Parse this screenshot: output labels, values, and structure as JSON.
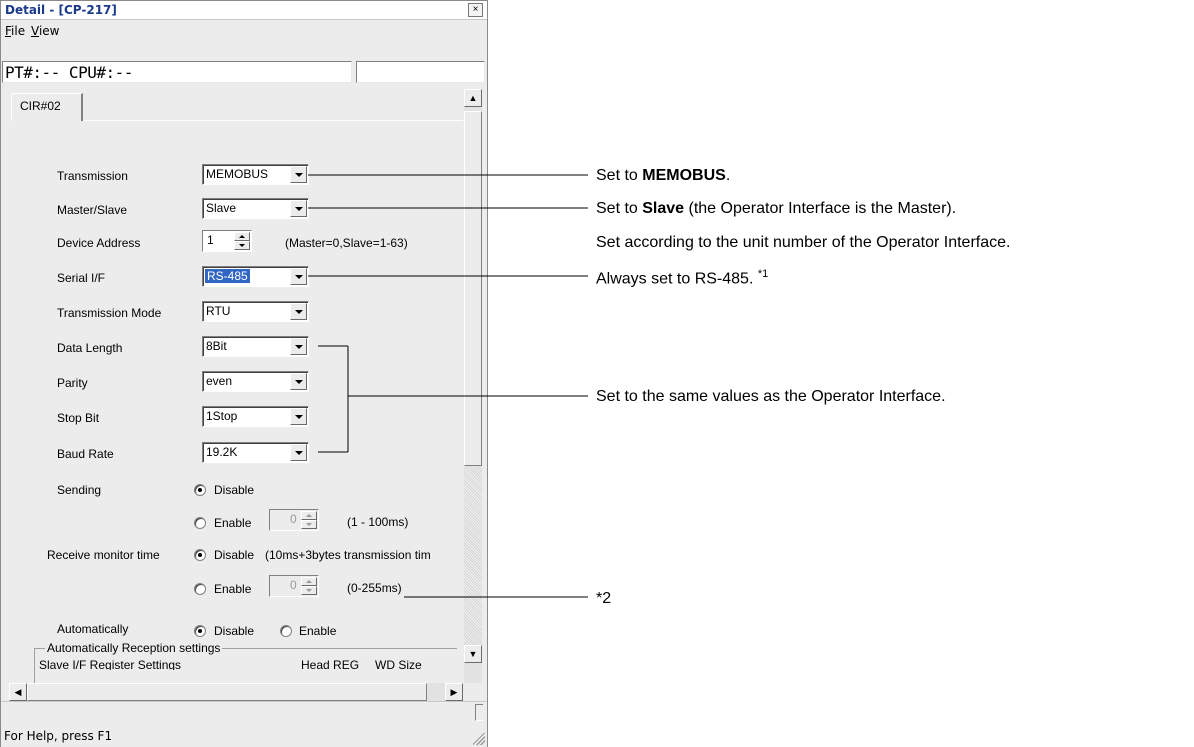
{
  "window": {
    "title": "Detail - [CP-217]",
    "close_label": "×",
    "menu": [
      {
        "underline": "F",
        "rest": "ile"
      },
      {
        "underline": "V",
        "rest": "iew"
      }
    ],
    "pt_cpu": "PT#:-- CPU#:--",
    "tab": "CIR#02",
    "status_help": "For Help, press F1"
  },
  "form": {
    "transmission": {
      "label": "Transmission",
      "value": "MEMOBUS"
    },
    "master_slave": {
      "label": "Master/Slave",
      "value": "Slave"
    },
    "device_address": {
      "label": "Device Address",
      "value": "1",
      "hint": "(Master=0,Slave=1-63)"
    },
    "serial_if": {
      "label": "Serial I/F",
      "value": "RS-485"
    },
    "transmission_mode": {
      "label": "Transmission Mode",
      "value": "RTU"
    },
    "data_length": {
      "label": "Data Length",
      "value": "8Bit"
    },
    "parity": {
      "label": "Parity",
      "value": "even"
    },
    "stop_bit": {
      "label": "Stop Bit",
      "value": "1Stop"
    },
    "baud_rate": {
      "label": "Baud Rate",
      "value": "19.2K"
    },
    "sending": {
      "label": "Sending",
      "disable": "Disable",
      "enable": "Enable",
      "selected": "Disable",
      "spin_value": "0",
      "range": "(1 - 100ms)"
    },
    "receive_monitor": {
      "label": "Receive monitor time",
      "disable": "Disable",
      "enable": "Enable",
      "selected": "Disable",
      "disable_hint": "(10ms+3bytes transmission tim",
      "spin_value": "0",
      "range": "(0-255ms)"
    },
    "automatically": {
      "label": "Automatically",
      "disable": "Disable",
      "enable": "Enable",
      "selected": "Disable"
    },
    "auto_reception": {
      "group_title": "Automatically Reception settings",
      "row_label": "Slave I/F Register Settings",
      "col_head_reg": "Head REG",
      "col_wd_size": "WD Size"
    }
  },
  "annotations": {
    "memobus_pre": "Set to ",
    "memobus_bold": "MEMOBUS",
    "memobus_post": ".",
    "slave_pre": "Set to ",
    "slave_bold": "Slave",
    "slave_post": " (the Operator Interface is the Master).",
    "unit_number": "Set according to the unit number of the Operator Interface.",
    "rs485": "Always set to RS-485. ",
    "rs485_footnote": "*1",
    "same_values": "Set to the same values as the Operator Interface.",
    "footnote2": "*2"
  }
}
